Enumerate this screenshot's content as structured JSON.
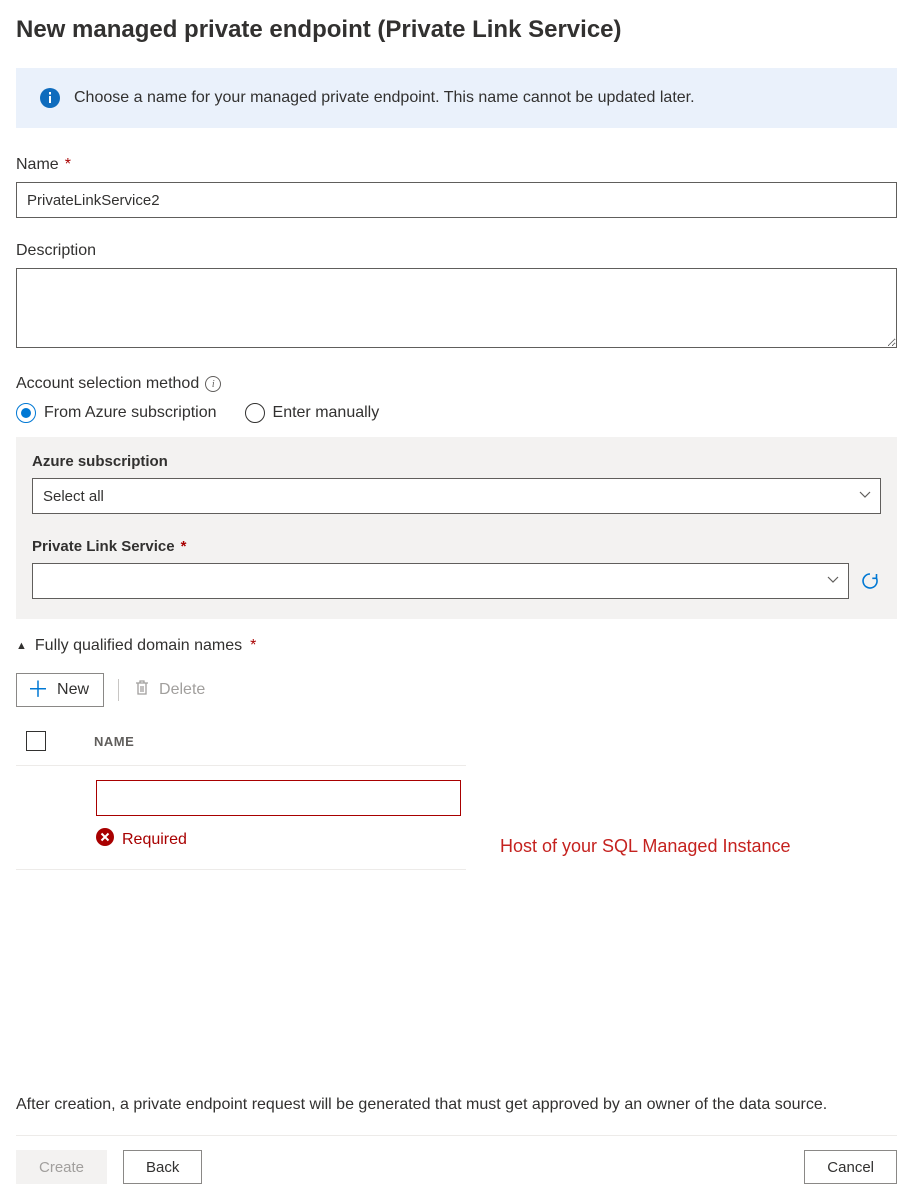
{
  "header": {
    "title": "New managed private endpoint (Private Link Service)"
  },
  "info_banner": {
    "text": "Choose a name for your managed private endpoint. This name cannot be updated later."
  },
  "name_field": {
    "label": "Name",
    "value": "PrivateLinkService2"
  },
  "description_field": {
    "label": "Description",
    "value": ""
  },
  "account_method": {
    "label": "Account selection method",
    "options": {
      "from_azure": "From Azure subscription",
      "enter_manually": "Enter manually"
    },
    "selected": "from_azure"
  },
  "azure_sub": {
    "label": "Azure subscription",
    "value": "Select all"
  },
  "pls": {
    "label": "Private Link Service",
    "value": ""
  },
  "fqdn_section": {
    "label": "Fully qualified domain names",
    "new_label": "New",
    "delete_label": "Delete",
    "col_name": "NAME",
    "error_text": "Required",
    "hint_overlay": "Host of your SQL Managed Instance"
  },
  "footer": {
    "note": "After creation, a private endpoint request will be generated that must get approved by an owner of the data source.",
    "create": "Create",
    "back": "Back",
    "cancel": "Cancel"
  }
}
